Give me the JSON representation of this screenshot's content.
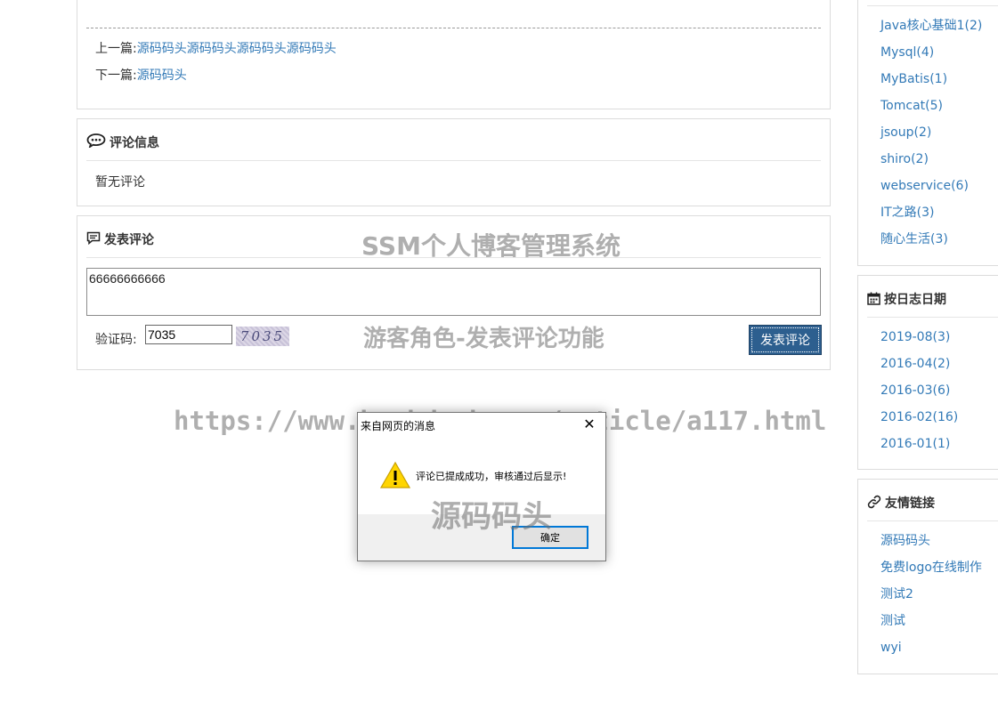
{
  "article_nav": {
    "prev_label": "上一篇:",
    "prev_title": "源码码头源码码头源码码头源码码头",
    "next_label": "下一篇:",
    "next_title": "源码码头"
  },
  "comments": {
    "title": "评论信息",
    "empty_text": "暂无评论"
  },
  "post_comment": {
    "title": "发表评论",
    "content_value": "66666666666",
    "captcha_label": "验证码:",
    "captcha_value": "7035",
    "captcha_image_text": "7035",
    "submit_label": "发表评论"
  },
  "sidebar": {
    "categories": [
      "Java核心基础1(2)",
      "Mysql(4)",
      "MyBatis(1)",
      "Tomcat(5)",
      "jsoup(2)",
      "shiro(2)",
      "webservice(6)",
      "IT之路(3)",
      "随心生活(3)"
    ],
    "date_title": "按日志日期",
    "dates": [
      "2019-08(3)",
      "2016-04(2)",
      "2016-03(6)",
      "2016-02(16)",
      "2016-01(1)"
    ],
    "links_title": "友情链接",
    "links": [
      "源码码头",
      "免费logo在线制作",
      "测试2",
      "测试",
      "wyi"
    ]
  },
  "watermarks": {
    "system_name": "SSM个人博客管理系统",
    "feature": "游客角色-发表评论功能",
    "url": "https://www.bookdock.com/article/a117.html",
    "brand": "源码码头"
  },
  "dialog": {
    "title": "来自网页的消息",
    "close_glyph": "✕",
    "message": "评论已提成成功，审核通过后显示!",
    "ok_label": "确定"
  },
  "colors": {
    "link": "#337ab7",
    "submit_button": "#2d5f8f",
    "dialog_button_border": "#0078d7"
  }
}
